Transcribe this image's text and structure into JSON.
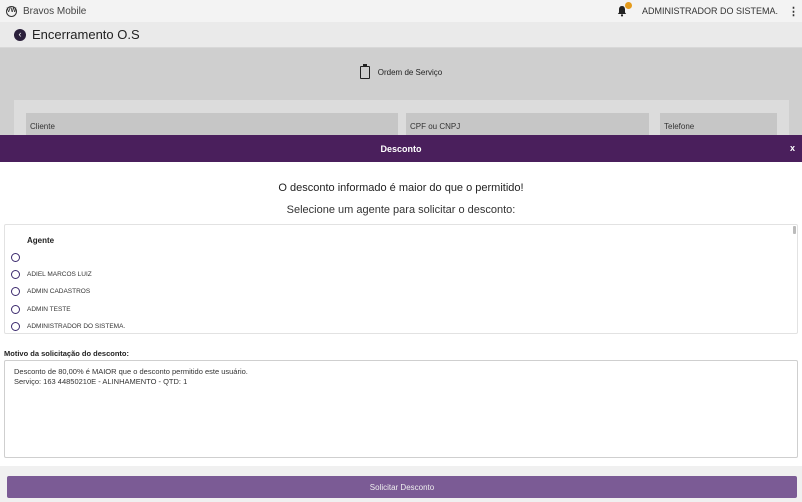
{
  "app": {
    "name": "Bravos Mobile",
    "logo": "vw-logo",
    "user": "ADMINISTRADOR DO SISTEMA.",
    "notification_icon": "bell-icon",
    "menu_icon": "kebab-icon"
  },
  "page": {
    "title": "Encerramento O.S",
    "section_label": "Ordem de Serviço",
    "fields": {
      "cliente": "Cliente",
      "cpf_cnpj": "CPF ou CNPJ",
      "telefone": "Telefone"
    }
  },
  "modal": {
    "title": "Desconto",
    "close_label": "x",
    "message_main": "O desconto informado é maior do que o permitido!",
    "message_sub": "Selecione um agente para solicitar o desconto:",
    "agent_header": "Agente",
    "agents": [
      "",
      "ADIEL MARCOS LUIZ",
      "ADMIN CADASTROS",
      "ADMIN TESTE",
      "ADMINISTRADOR DO SISTEMA."
    ],
    "reason_label": "Motivo da solicitação do desconto:",
    "reason_text": "Desconto de 80,00% é MAIOR que o desconto permitido este usuário.\nServiço: 163 44850210E - ALINHAMENTO - QTD: 1",
    "submit_label": "Solicitar Desconto"
  },
  "colors": {
    "modal_header": "#4a1f5c",
    "button": "#7b5b95",
    "radio": "#3c2a6e"
  }
}
